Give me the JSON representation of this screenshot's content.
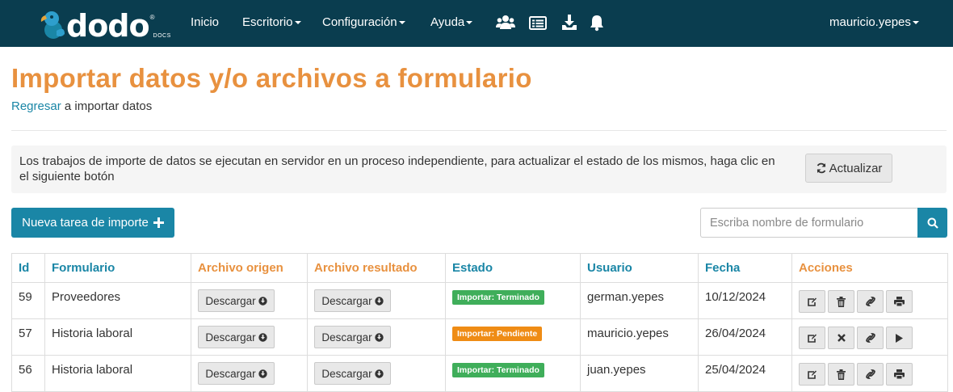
{
  "navbar": {
    "logo_text": "dodo",
    "logo_sub": "DOCS",
    "logo_reg": "®",
    "menu": [
      {
        "label": "Inicio",
        "has_dropdown": false
      },
      {
        "label": "Escritorio",
        "has_dropdown": true
      },
      {
        "label": "Configuración",
        "has_dropdown": true
      },
      {
        "label": "Ayuda",
        "has_dropdown": true
      }
    ],
    "icons": [
      "users-icon",
      "list-icon",
      "download-icon",
      "bell-icon"
    ],
    "user": "mauricio.yepes",
    "background_color": "#0a3d4f"
  },
  "page": {
    "title": "Importar datos y/o archivos a formulario",
    "breadcrumb_link": "Regresar",
    "breadcrumb_text": " a importar datos",
    "title_color": "#e8913f",
    "accent_color": "#1a86a6"
  },
  "info": {
    "text": "Los trabajos de importe de datos se ejecutan en servidor en un proceso independiente, para actualizar el estado de los mismos, haga clic en el siguiente botón",
    "refresh_label": "Actualizar"
  },
  "actions": {
    "new_task_label": "Nueva tarea de importe",
    "search_placeholder": "Escriba nombre de formulario"
  },
  "table": {
    "headers": [
      "Id",
      "Formulario",
      "Archivo origen",
      "Archivo resultado",
      "Estado",
      "Usuario",
      "Fecha",
      "Acciones"
    ],
    "download_label": "Descargar",
    "rows": [
      {
        "id": "59",
        "form": "Proveedores",
        "status": "Importar: Terminado",
        "status_type": "ok",
        "user": "german.yepes",
        "date": "10/12/2024",
        "actions": [
          "edit-icon",
          "trash-icon",
          "link-icon",
          "print-icon"
        ]
      },
      {
        "id": "57",
        "form": "Historia laboral",
        "status": "Importar: Pendiente",
        "status_type": "pending",
        "user": "mauricio.yepes",
        "date": "26/04/2024",
        "actions": [
          "edit-icon",
          "close-icon",
          "link-icon",
          "play-icon"
        ]
      },
      {
        "id": "56",
        "form": "Historia laboral",
        "status": "Importar: Terminado",
        "status_type": "ok",
        "user": "juan.yepes",
        "date": "25/04/2024",
        "actions": [
          "edit-icon",
          "trash-icon",
          "link-icon",
          "print-icon"
        ]
      }
    ],
    "status_colors": {
      "ok": "#3fae5a",
      "pending": "#ef8c15"
    }
  }
}
